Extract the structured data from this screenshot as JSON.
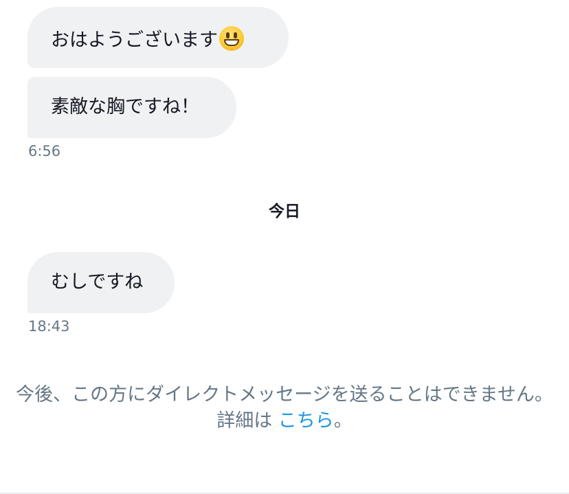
{
  "messages": [
    {
      "text": "おはようございます",
      "emoji": "grinning-face-emoji"
    },
    {
      "text": "素敵な胸ですね！"
    },
    {
      "text": "むしですね"
    }
  ],
  "timestamps": [
    "6:56",
    "18:43"
  ],
  "day_divider": "今日",
  "notice": {
    "text": "今後、この方にダイレクトメッセージを送ることはできません。詳細は ",
    "link_text": "こちら",
    "suffix": "。"
  },
  "colors": {
    "bubble_bg": "#eff1f2",
    "text": "#141823",
    "muted": "#657786",
    "link": "#1b95e0"
  }
}
